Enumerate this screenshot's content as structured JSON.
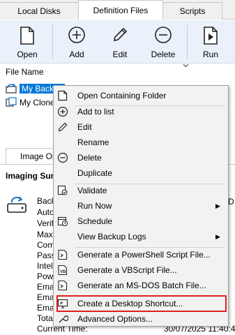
{
  "tabs": [
    "Local Disks",
    "Definition Files",
    "Scripts"
  ],
  "active_tab": "Definition Files",
  "toolbar": {
    "open": "Open",
    "add": "Add",
    "edit": "Edit",
    "delete": "Delete",
    "run": "Run"
  },
  "file_list": {
    "column_header": "File Name",
    "items": [
      "My Backup",
      "My Clone"
    ]
  },
  "lower_panel": {
    "tab": "Image Options",
    "summary_title": "Imaging Summary",
    "items": [
      "Backup",
      "Auto",
      "Verify",
      "Max",
      "Compress",
      "Password",
      "Intelligent",
      "Power",
      "Email",
      "Email",
      "Email",
      "Total"
    ],
    "right_partial": "D",
    "current_time_label": "Current Time:",
    "current_time_value": "30/07/2025 11:40:48"
  },
  "context_menu": {
    "items": [
      {
        "label": "Open Containing Folder",
        "icon": "folder-icon"
      },
      {
        "label": "Add to list",
        "icon": "add-icon"
      },
      {
        "label": "Edit",
        "icon": "pencil-icon"
      },
      {
        "label": "Rename",
        "icon": ""
      },
      {
        "label": "Delete",
        "icon": "minus-icon"
      },
      {
        "label": "Duplicate",
        "icon": ""
      },
      {
        "label": "Validate",
        "icon": "validate-icon"
      },
      {
        "label": "Run Now",
        "icon": ""
      },
      {
        "label": "Schedule",
        "icon": "schedule-icon"
      },
      {
        "label": "View Backup Logs",
        "icon": ""
      },
      {
        "label": "Generate a PowerShell Script File...",
        "icon": "powershell-icon"
      },
      {
        "label": "Generate a VBScript File...",
        "icon": "vbscript-icon"
      },
      {
        "label": "Generate an MS-DOS Batch File...",
        "icon": "batch-icon"
      },
      {
        "label": "Create a Desktop Shortcut...",
        "icon": "desktop-shortcut-icon"
      },
      {
        "label": "Advanced Options...",
        "icon": "wrench-icon"
      }
    ],
    "highlight_color": "#e0201b"
  },
  "colors": {
    "selection": "#0078d7",
    "ribbon_bg": "#eaf1fb"
  }
}
